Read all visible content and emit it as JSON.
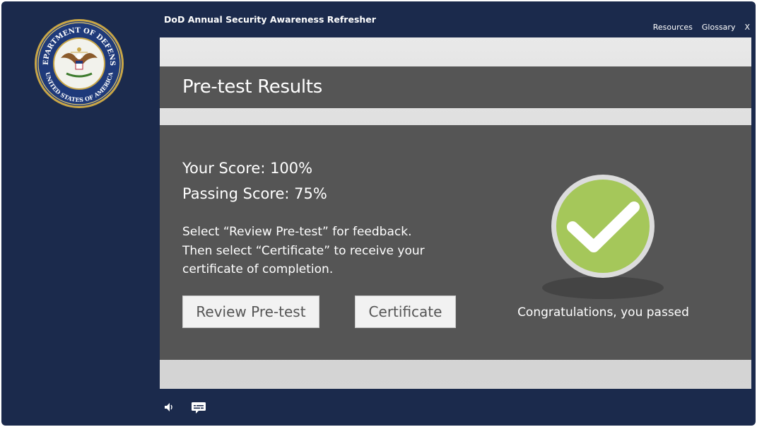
{
  "header": {
    "course_title": "DoD Annual Security Awareness Refresher",
    "nav": {
      "resources": "Resources",
      "glossary": "Glossary",
      "close": "X"
    },
    "seal": {
      "icon": "dod-seal-icon",
      "top_text": "DEPARTMENT OF DEFENSE",
      "bottom_text": "UNITED STATES OF AMERICA"
    }
  },
  "results": {
    "title": "Pre-test Results",
    "your_score": "Your Score: 100%",
    "passing_score": "Passing Score: 75%",
    "instructions": [
      "Select “Review Pre-test” for feedback.",
      "Then select “Certificate” to receive your",
      "certificate of completion."
    ],
    "buttons": {
      "review": "Review Pre-test",
      "certificate": "Certificate"
    },
    "status_icon": "checkmark-icon",
    "status_message": "Congratulations, you passed"
  },
  "footer": {
    "audio_icon": "speaker-icon",
    "captions_icon": "captions-icon"
  },
  "colors": {
    "frame": "#1b2a4c",
    "panel": "#555555",
    "check_green": "#a5c75a",
    "button_bg": "#f2f2f2"
  }
}
